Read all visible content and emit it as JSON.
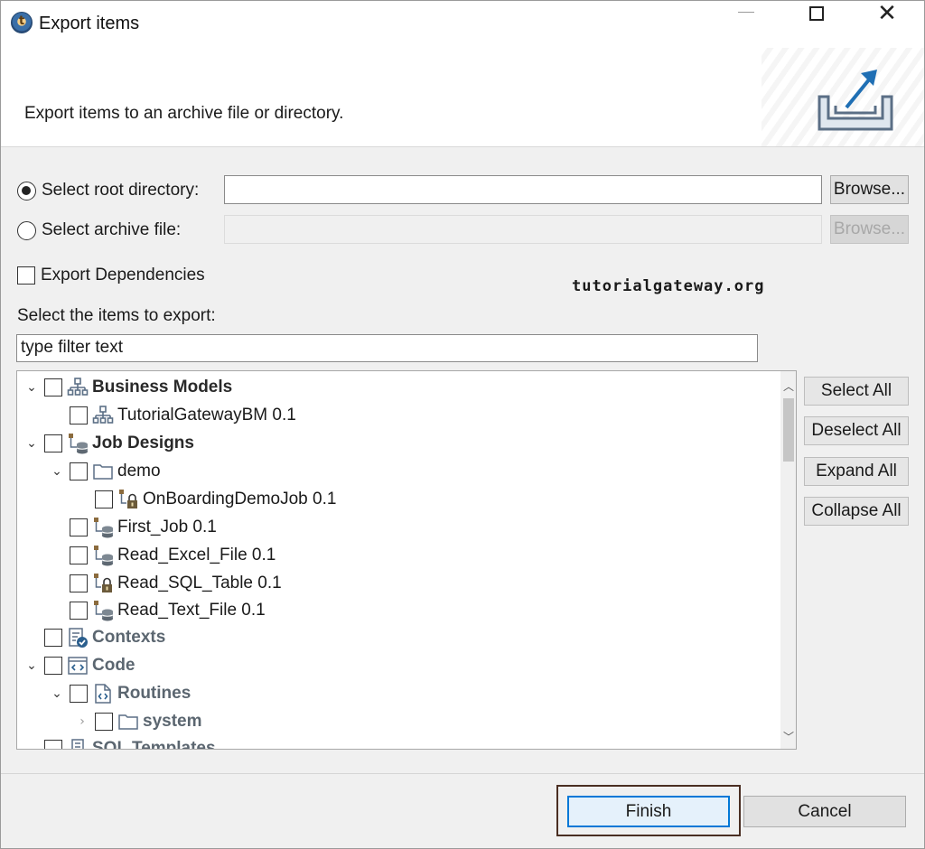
{
  "window": {
    "title": "Export items"
  },
  "banner": {
    "description": "Export items to an archive file or directory."
  },
  "source": {
    "root_directory_label": "Select root directory:",
    "root_directory_value": "",
    "archive_file_label": "Select archive file:",
    "archive_file_value": "",
    "selected": "root_directory",
    "browse_label": "Browse...",
    "browse_disabled_label": "Browse..."
  },
  "export_dependencies": {
    "label": "Export Dependencies",
    "checked": false
  },
  "watermark": "tutorialgateway.org",
  "items_label": "Select the items to export:",
  "filter": {
    "placeholder": "type filter text",
    "value": "type filter text"
  },
  "tree": {
    "items": [
      {
        "label": "Business Models",
        "style": "bold",
        "icon": "business-model-icon",
        "expanded": true
      },
      {
        "label": "TutorialGatewayBM 0.1",
        "style": "normal",
        "icon": "business-model-icon"
      },
      {
        "label": "Job Designs",
        "style": "bold",
        "icon": "job-design-icon",
        "expanded": true
      },
      {
        "label": "demo",
        "style": "normal",
        "icon": "folder-icon",
        "expanded": true
      },
      {
        "label": "OnBoardingDemoJob 0.1",
        "style": "normal",
        "icon": "locked-job-icon"
      },
      {
        "label": "First_Job 0.1",
        "style": "normal",
        "icon": "job-icon"
      },
      {
        "label": "Read_Excel_File 0.1",
        "style": "normal",
        "icon": "job-icon"
      },
      {
        "label": "Read_SQL_Table 0.1",
        "style": "normal",
        "icon": "locked-job-icon"
      },
      {
        "label": "Read_Text_File 0.1",
        "style": "normal",
        "icon": "job-icon"
      },
      {
        "label": "Contexts",
        "style": "gray",
        "icon": "contexts-icon"
      },
      {
        "label": "Code",
        "style": "gray",
        "icon": "code-icon",
        "expanded": true
      },
      {
        "label": "Routines",
        "style": "gray",
        "icon": "routines-icon",
        "expanded": true
      },
      {
        "label": "system",
        "style": "gray",
        "icon": "folder-icon",
        "expanded": false
      },
      {
        "label": "SQL Templates",
        "style": "gray",
        "icon": "sql-templates-icon",
        "expanded": true
      }
    ]
  },
  "side_buttons": {
    "select_all": "Select All",
    "deselect_all": "Deselect All",
    "expand_all": "Expand All",
    "collapse_all": "Collapse All"
  },
  "footer": {
    "finish": "Finish",
    "cancel": "Cancel"
  },
  "colors": {
    "accent": "#0078d7",
    "highlight_frame": "#4a2e22",
    "folder_stroke": "#5b6f86",
    "job_brown": "#8b6b3d"
  }
}
